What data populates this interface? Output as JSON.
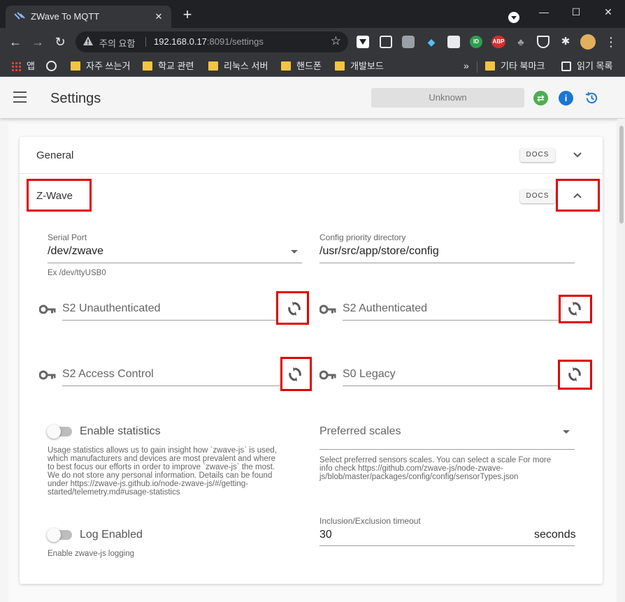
{
  "browser": {
    "tab_title": "ZWave To MQTT",
    "tab_close": "✕",
    "new_tab": "+",
    "warning_text": "주의 요함",
    "url_host": "192.168.0.17",
    "url_rest": ":8091/settings",
    "window_controls": {
      "minimize": "—",
      "maximize": "☐",
      "close": "✕"
    },
    "menu": "⋮",
    "extensions": [
      "download-ext-icon",
      "pip-ext-icon",
      "camera-ext-icon",
      "gem-ext-icon",
      "cast-ext-icon",
      "id-ext-icon",
      "adblock-plus-icon",
      "cat-ext-icon",
      "shield-ext-icon",
      "puzzle-extensions-icon",
      "profile-avatar"
    ],
    "ext_labels": {
      "id": "ID",
      "abp": "ABP"
    }
  },
  "bookmarks": {
    "items": [
      {
        "label": "앱",
        "icon": "apps-grid-icon"
      },
      {
        "label": "",
        "icon": "globe-icon"
      },
      {
        "label": "자주 쓰는거",
        "icon": "folder-icon"
      },
      {
        "label": "학교 관련",
        "icon": "folder-icon"
      },
      {
        "label": "리눅스 서버",
        "icon": "folder-icon"
      },
      {
        "label": "핸드폰",
        "icon": "folder-icon"
      },
      {
        "label": "개발보드",
        "icon": "folder-icon"
      }
    ],
    "more": "»",
    "other_bookmarks": "기타 북마크",
    "reading_list": "읽기 목록"
  },
  "appbar": {
    "title": "Settings",
    "status": "Unknown",
    "colors": {
      "swap": "#4caf50",
      "info": "#1976d2",
      "history": "#1976d2"
    },
    "info_glyph": "i"
  },
  "sections": {
    "general": {
      "title": "General",
      "docs": "DOCS"
    },
    "zwave": {
      "title": "Z-Wave",
      "docs": "DOCS"
    }
  },
  "zwave": {
    "serial_port": {
      "label": "Serial Port",
      "value": "/dev/zwave",
      "hint": "Ex /dev/ttyUSB0"
    },
    "config_dir": {
      "label": "Config priority directory",
      "value": "/usr/src/app/store/config"
    },
    "keys": {
      "s2_unauth": "S2 Unauthenticated",
      "s2_auth": "S2 Authenticated",
      "s2_access": "S2 Access Control",
      "s0_legacy": "S0 Legacy"
    },
    "statistics": {
      "label": "Enable statistics",
      "enabled": false,
      "hint_lines": [
        "Usage statistics allows us to gain insight how `zwave-js` is used,",
        "which manufacturers and devices are most prevalent and where",
        "to best focus our efforts in order to improve `zwave-js` the most.",
        "We do not store any personal information. Details can be found",
        "under https://zwave-js.github.io/node-zwave-js/#/getting-",
        "started/telemetry.md#usage-statistics"
      ]
    },
    "preferred_scales": {
      "placeholder": "Preferred scales",
      "hint_lines": [
        "Select preferred sensors scales. You can select a scale For more",
        "info check https://github.com/zwave-js/node-zwave-",
        "js/blob/master/packages/config/config/sensorTypes.json"
      ]
    },
    "log": {
      "label": "Log Enabled",
      "enabled": false,
      "hint": "Enable zwave-js logging"
    },
    "timeout": {
      "label": "Inclusion/Exclusion timeout",
      "value": "30",
      "suffix": "seconds"
    }
  },
  "highlight_color": "#e00000"
}
